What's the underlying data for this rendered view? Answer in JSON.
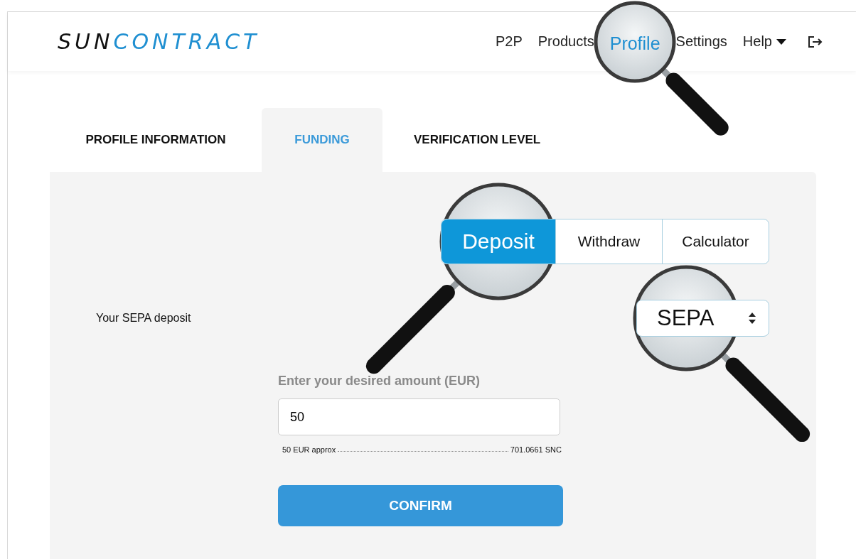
{
  "logo": {
    "dark": "SUN",
    "accent": "CONTRACT"
  },
  "nav": [
    {
      "label": "P2P",
      "kind": "link",
      "selected": false
    },
    {
      "label": "Products",
      "kind": "link",
      "selected": false
    },
    {
      "label": "Profile",
      "kind": "magnified",
      "selected": true
    },
    {
      "label": "Settings",
      "kind": "link",
      "selected": false
    },
    {
      "label": "Help",
      "kind": "dropdown",
      "selected": false
    }
  ],
  "tabs": [
    {
      "label": "PROFILE INFORMATION",
      "selected": false
    },
    {
      "label": "FUNDING",
      "selected": true
    },
    {
      "label": "VERIFICATION LEVEL",
      "selected": false
    }
  ],
  "modes": [
    {
      "label": "Deposit",
      "selected": true,
      "magnified": true
    },
    {
      "label": "Withdraw",
      "selected": false,
      "magnified": false
    },
    {
      "label": "Calculator",
      "selected": false,
      "magnified": false
    }
  ],
  "section_label": "Your SEPA deposit",
  "method_select": {
    "value": "SEPA",
    "magnified": true
  },
  "amount": {
    "label": "Enter your desired amount (EUR)",
    "value": "50"
  },
  "conversion": {
    "left": "50 EUR approx",
    "right": "701.0661 SNC"
  },
  "confirm_button": "CONFIRM"
}
